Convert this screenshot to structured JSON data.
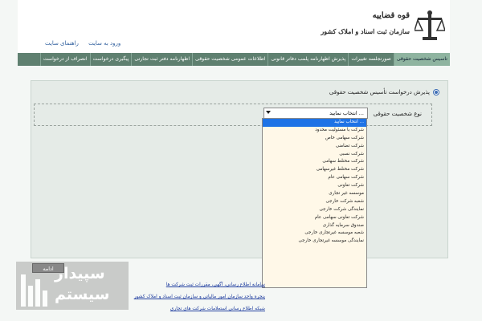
{
  "header": {
    "org_title": "قوه قضاییه",
    "org_name": "سازمان ثبت اسناد و املاک کشور",
    "top_links": [
      "ورود به سایت",
      "راهنمای سایت"
    ]
  },
  "nav": {
    "items": [
      "تاسیس شخصیت حقوقی",
      "صورتجلسه تغییرات",
      "پذیرش اظهارنامه پلمب دفاتر قانونی",
      "اطلاعات عمومی شخصیت حقوقی",
      "اظهارنامه دفتر ثبت تجارتی",
      "پیگیری درخواست",
      "انصراف از درخواست"
    ],
    "active_index": 0
  },
  "form": {
    "radio_label": "پذیرش درخواست تأسیس شخصیت حقوقی",
    "field_label": "نوع شخصیت حقوقی",
    "select_value": "انتخاب نمایید ...",
    "submit_label": "ادامه"
  },
  "dropdown": {
    "options": [
      "انتخاب نمایید ...",
      "شرکت با مسئولیت محدود",
      "شرکت سهامی خاص",
      "شرکت تضامنی",
      "شرکت نسبی",
      "شرکت مختلط سهامی",
      "شرکت مختلط غیرسهامی",
      "شرکت سهامی عام",
      "شرکت تعاونی",
      "موسسه غیر تجاری",
      "شعبه شرکت خارجی",
      "نمایندگی شرکت خارجی",
      "شرکت تعاونی سهامی عام",
      "صندوق سرمایه گذاری",
      "شعبه موسسه غیرتجاری خارجی",
      "نمایندگی موسسه غیرتجاری خارجی"
    ],
    "selected_index": 0
  },
  "footer": {
    "links": [
      "سامانه اطلاع رسانی، آگهی، مقررات ثبت شرکت ها",
      "پنجره واحد سازمان امور مالیاتی و سازمان ثبت اسناد و املاک کشور",
      "شبکه اطلاع رسانی استعلامات شرکت های تجاری"
    ]
  },
  "watermark": {
    "line1": "سپیدار",
    "line2": "سیستم"
  },
  "colors": {
    "nav_bg": "#5f8070",
    "nav_active": "#8fb4a0",
    "selected_option": "#1e73e6",
    "dropdown_bg": "#fff8e8"
  }
}
